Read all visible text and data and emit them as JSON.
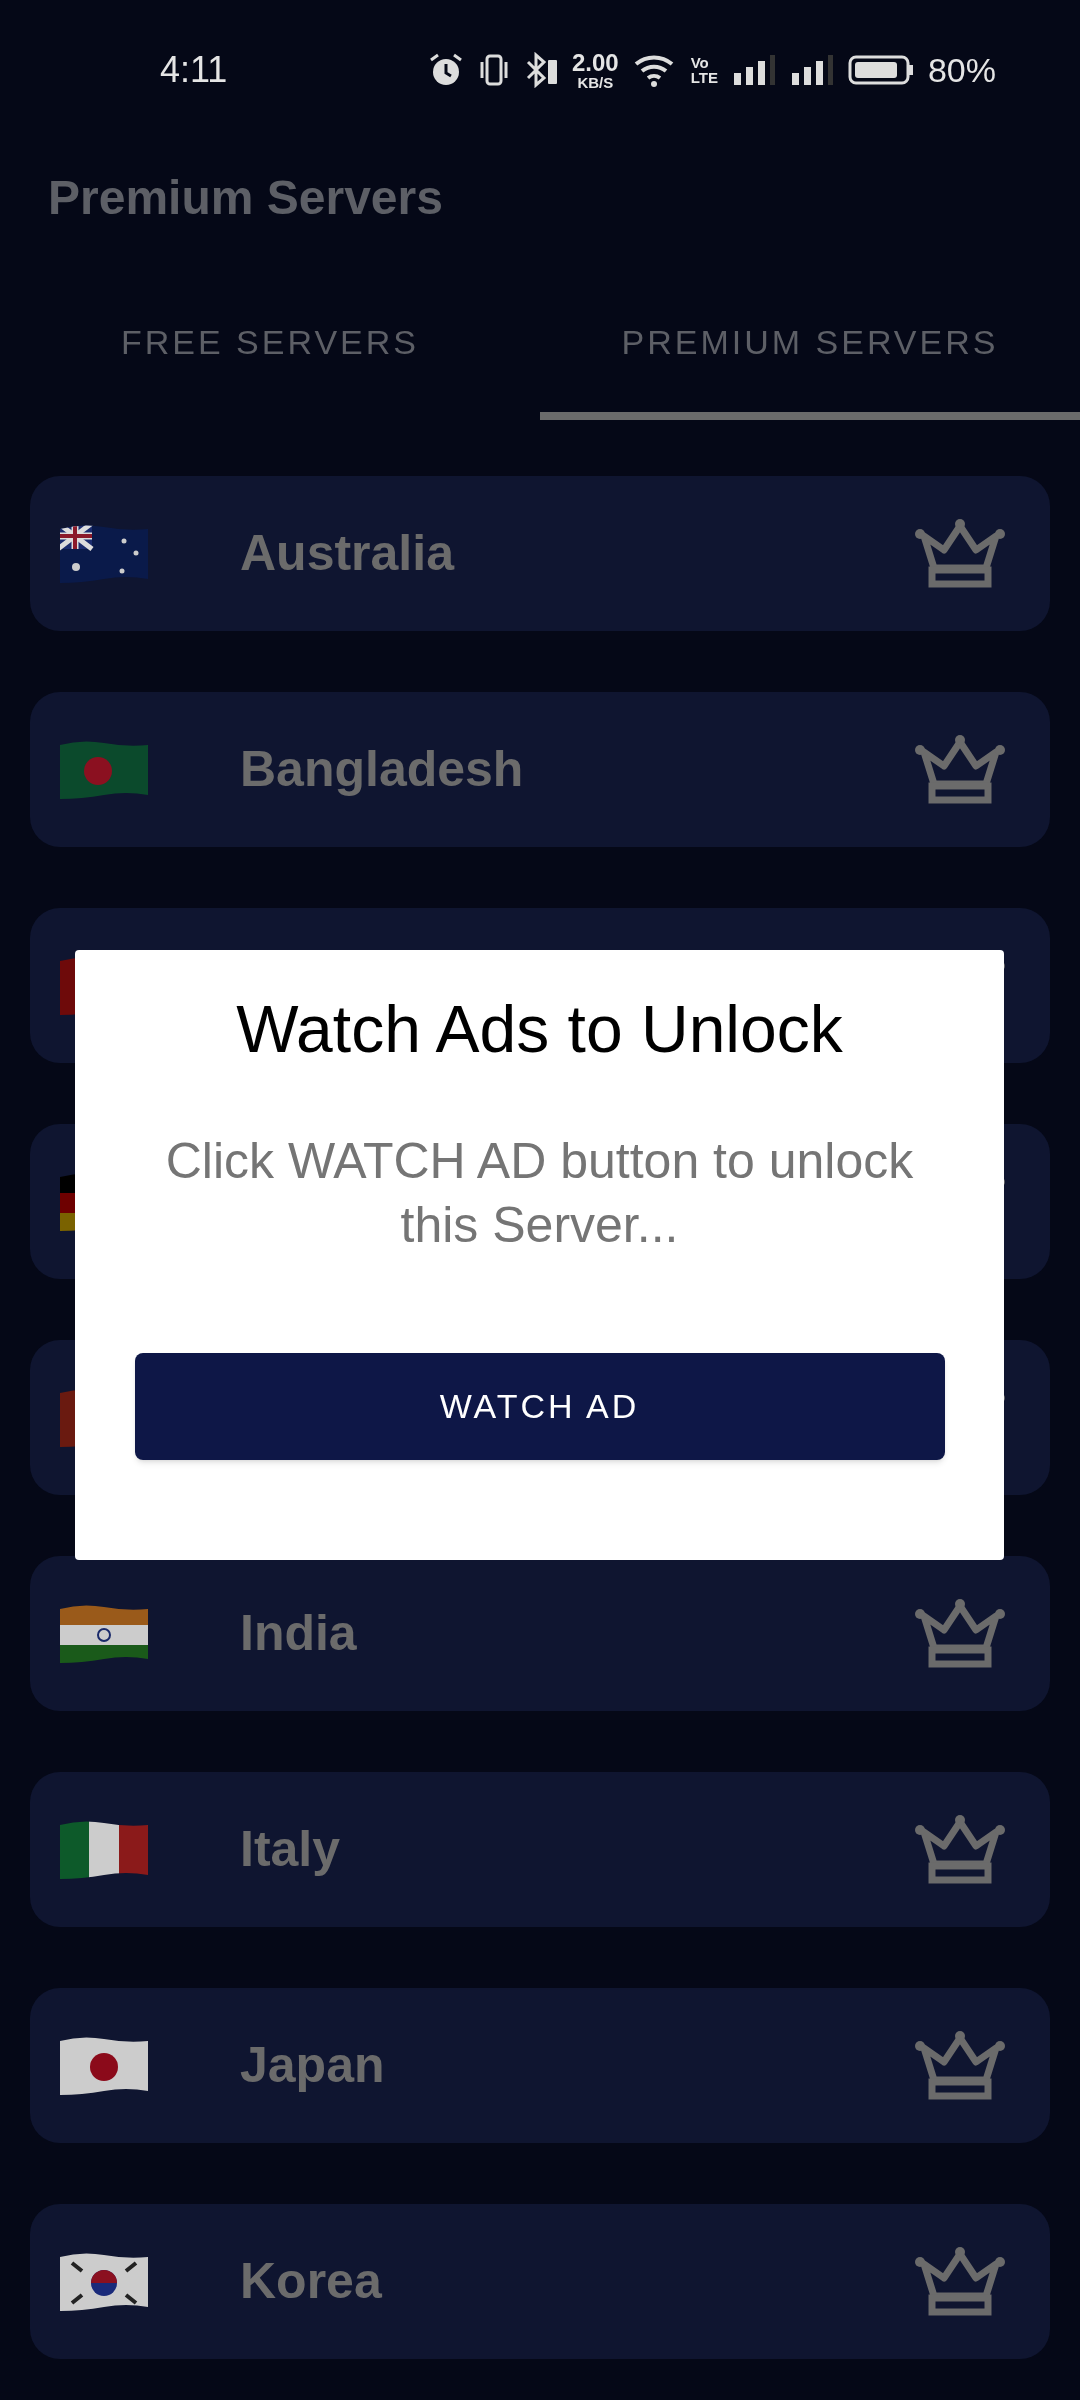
{
  "status_bar": {
    "time": "4:11",
    "speed_value": "2.00",
    "speed_unit": "KB/S",
    "volte_top": "Vo",
    "volte_bottom": "LTE",
    "battery": "80%"
  },
  "title": "Premium Servers",
  "tabs": [
    {
      "label": "FREE SERVERS",
      "selected": false
    },
    {
      "label": "PREMIUM SERVERS",
      "selected": true
    }
  ],
  "servers": [
    {
      "name": "Australia",
      "kind": "au"
    },
    {
      "name": "Bangladesh",
      "kind": "bd"
    },
    {
      "kind": "red"
    },
    {
      "kind": "de"
    },
    {
      "kind": "orange"
    },
    {
      "name": "India",
      "kind": "in"
    },
    {
      "name": "Italy",
      "kind": "it"
    },
    {
      "name": "Japan",
      "kind": "jp"
    },
    {
      "name": "Korea",
      "kind": "kr"
    }
  ],
  "dialog": {
    "title": "Watch Ads to Unlock",
    "message": "Click WATCH AD button to unlock this Server...",
    "button": "WATCH AD"
  }
}
